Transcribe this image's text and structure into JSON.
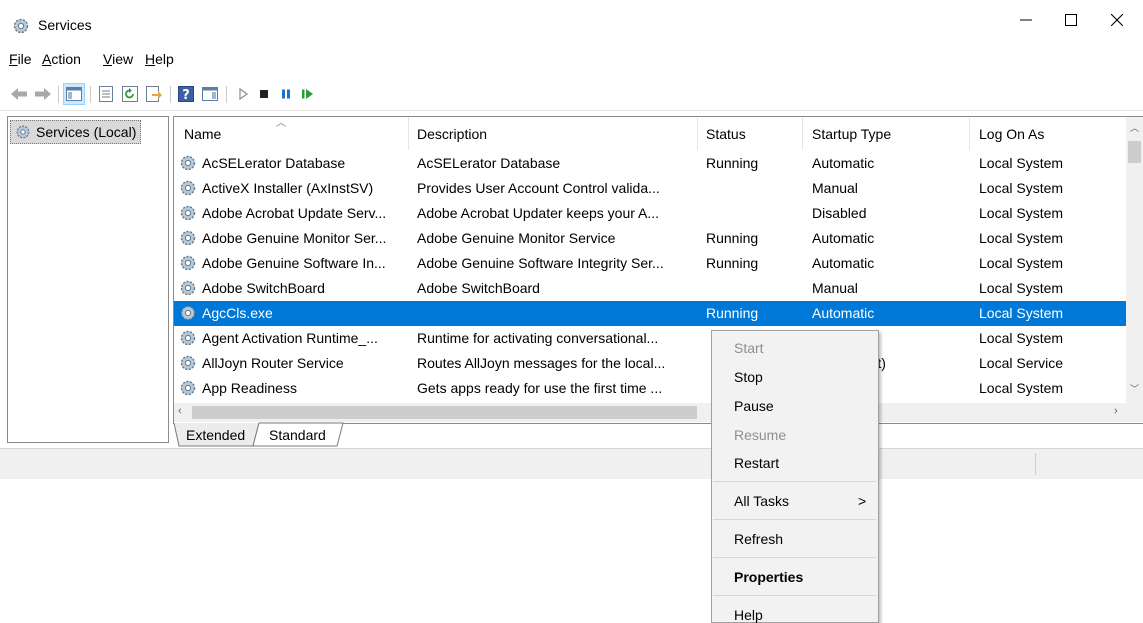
{
  "window": {
    "title": "Services",
    "controls": {
      "minimize": "—",
      "maximize": "☐",
      "close": "✕"
    }
  },
  "menubar": {
    "items": [
      {
        "label": "File",
        "key": "F",
        "rest": "ile"
      },
      {
        "label": "Action",
        "key": "A",
        "rest": "ction"
      },
      {
        "label": "View",
        "key": "V",
        "rest": "iew"
      },
      {
        "label": "Help",
        "key": "H",
        "rest": "elp"
      }
    ]
  },
  "toolbar": {
    "buttons": [
      "back-arrow-icon",
      "forward-arrow-icon",
      "show-hide-console-tree-icon",
      "properties-sheet-icon",
      "refresh-icon",
      "export-list-icon",
      "help-icon",
      "show-hide-action-pane-icon",
      "start-service-icon",
      "stop-service-icon",
      "pause-service-icon",
      "restart-service-icon"
    ]
  },
  "tree": {
    "root_label": "Services (Local)"
  },
  "table": {
    "columns": [
      "Name",
      "Description",
      "Status",
      "Startup Type",
      "Log On As"
    ],
    "rows": [
      {
        "name": "AcSELerator Database",
        "description": "AcSELerator Database",
        "status": "Running",
        "startup": "Automatic",
        "logon": "Local System"
      },
      {
        "name": "ActiveX Installer (AxInstSV)",
        "description": "Provides User Account Control valida...",
        "status": "",
        "startup": "Manual",
        "logon": "Local System"
      },
      {
        "name": "Adobe Acrobat Update Serv...",
        "description": "Adobe Acrobat Updater keeps your A...",
        "status": "",
        "startup": "Disabled",
        "logon": "Local System"
      },
      {
        "name": "Adobe Genuine Monitor Ser...",
        "description": "Adobe Genuine Monitor Service",
        "status": "Running",
        "startup": "Automatic",
        "logon": "Local System"
      },
      {
        "name": "Adobe Genuine Software In...",
        "description": "Adobe Genuine Software Integrity Ser...",
        "status": "Running",
        "startup": "Automatic",
        "logon": "Local System"
      },
      {
        "name": "Adobe SwitchBoard",
        "description": "Adobe SwitchBoard",
        "status": "",
        "startup": "Manual",
        "logon": "Local System"
      },
      {
        "name": "AgcCls.exe",
        "description": "",
        "status": "Running",
        "startup": "Automatic",
        "logon": "Local System"
      },
      {
        "name": "Agent Activation Runtime_...",
        "description": "Runtime for activating conversational...",
        "status": "",
        "startup": "",
        "logon": "Local System"
      },
      {
        "name": "AllJoyn Router Service",
        "description": "Routes AllJoyn messages for the local...",
        "status": "",
        "startup": "rigger Start)",
        "logon": "Local Service"
      },
      {
        "name": "App Readiness",
        "description": "Gets apps ready for use the first time ...",
        "status": "",
        "startup": "",
        "logon": "Local System"
      }
    ],
    "selected_index": 6
  },
  "tabs": {
    "extended": "Extended",
    "standard": "Standard"
  },
  "context_menu": {
    "start": "Start",
    "stop": "Stop",
    "pause": "Pause",
    "resume": "Resume",
    "restart": "Restart",
    "all_tasks": "All Tasks",
    "all_tasks_arrow": ">",
    "refresh": "Refresh",
    "properties": "Properties",
    "help": "Help"
  },
  "colors": {
    "selection": "#0078d7",
    "menu_bg": "#f2f2f2",
    "disabled_text": "#8f8f8f"
  }
}
